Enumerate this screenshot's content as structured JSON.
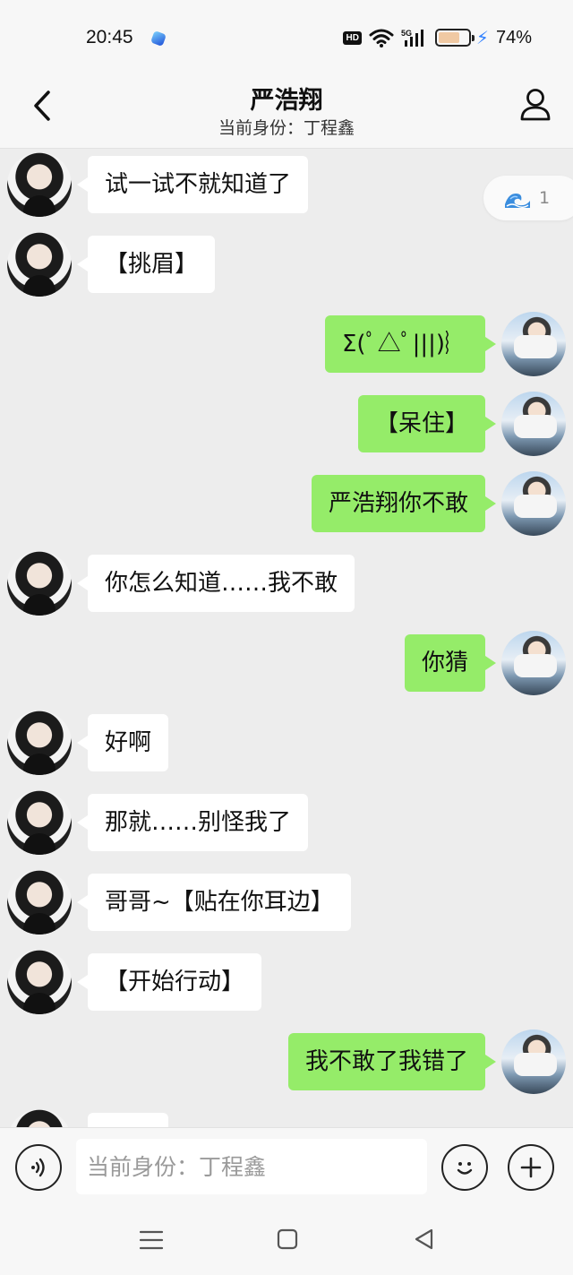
{
  "status_bar": {
    "time": "20:45",
    "hd_label": "HD",
    "network": "5G",
    "battery_percent": "74%",
    "battery_level": 0.74,
    "charging": true
  },
  "header": {
    "title": "严浩翔",
    "subtitle": "当前身份：丁程鑫",
    "icons": {
      "back": "back-chevron-icon",
      "profile": "person-icon"
    }
  },
  "float_badge": {
    "icon": "wave-icon",
    "count": "1"
  },
  "messages": [
    {
      "side": "left",
      "text": "试一试不就知道了"
    },
    {
      "side": "left",
      "text": "【挑眉】"
    },
    {
      "side": "right",
      "text": "Σ(ﾟ△ﾟ|||)︴"
    },
    {
      "side": "right",
      "text": "【呆住】"
    },
    {
      "side": "right",
      "text": "严浩翔你不敢"
    },
    {
      "side": "left",
      "text": "你怎么知道……我不敢"
    },
    {
      "side": "right",
      "text": "你猜"
    },
    {
      "side": "left",
      "text": "好啊"
    },
    {
      "side": "left",
      "text": "那就……别怪我了"
    },
    {
      "side": "left",
      "text": "哥哥~【贴在你耳边】"
    },
    {
      "side": "left",
      "text": "【开始行动】"
    },
    {
      "side": "right",
      "text": "我不敢了我错了"
    }
  ],
  "input_bar": {
    "placeholder": "当前身份：丁程鑫",
    "value": "",
    "icons": {
      "voice": "voice-icon",
      "emoji": "smiley-icon",
      "more": "plus-icon"
    }
  },
  "nav_bar": {
    "icons": {
      "menu": "menu-icon",
      "home": "home-square-icon",
      "back": "back-triangle-icon"
    }
  }
}
